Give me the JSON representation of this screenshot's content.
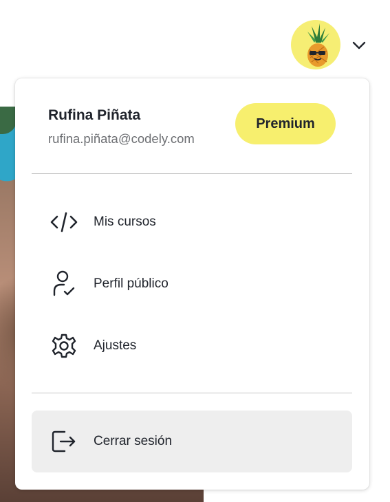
{
  "header": {
    "avatar_alt": "Pineapple avatar",
    "chevron_icon": "chevron-down-icon"
  },
  "user": {
    "name": "Rufina Piñata",
    "email": "rufina.piñata@codely.com",
    "badge": "Premium"
  },
  "menu": {
    "items": [
      {
        "label": "Mis cursos",
        "icon": "code-icon"
      },
      {
        "label": "Perfil público",
        "icon": "user-check-icon"
      },
      {
        "label": "Ajustes",
        "icon": "gear-icon"
      }
    ],
    "logout": {
      "label": "Cerrar sesión",
      "icon": "logout-icon"
    }
  },
  "colors": {
    "badge_bg": "#f7ef6e",
    "avatar_bg": "#f6ee74",
    "text_primary": "#20242c",
    "text_secondary": "#6d6f73",
    "logout_bg": "#eeeeee"
  }
}
